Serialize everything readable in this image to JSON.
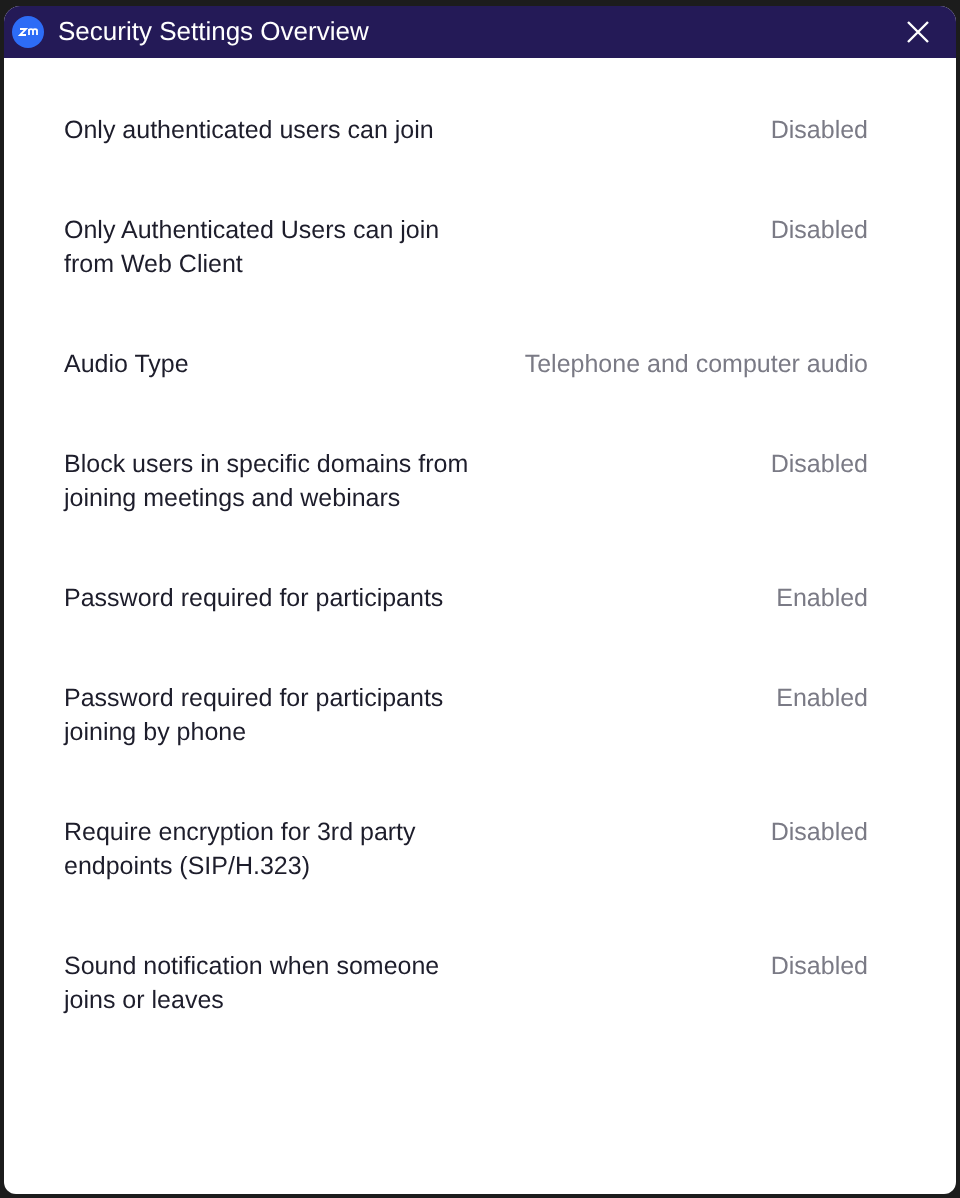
{
  "window": {
    "title": "Security Settings Overview"
  },
  "settings": [
    {
      "label": "Only authenticated users can join",
      "value": "Disabled"
    },
    {
      "label": "Only Authenticated Users can join from Web Client",
      "value": "Disabled"
    },
    {
      "label": "Audio Type",
      "value": "Telephone and computer audio"
    },
    {
      "label": "Block users in specific domains from joining meetings and webinars",
      "value": "Disabled"
    },
    {
      "label": "Password required for participants",
      "value": "Enabled"
    },
    {
      "label": "Password required for participants joining by phone",
      "value": "Enabled"
    },
    {
      "label": "Require encryption for 3rd party endpoints (SIP/H.323)",
      "value": "Disabled"
    },
    {
      "label": "Sound notification when someone joins or leaves",
      "value": "Disabled"
    }
  ]
}
